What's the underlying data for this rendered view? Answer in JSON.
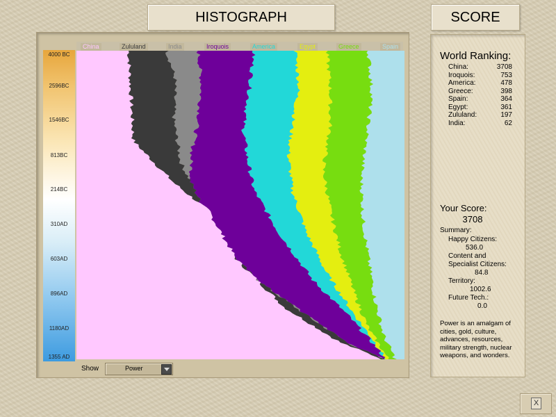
{
  "header": {
    "histograph_title": "HISTOGRAPH",
    "score_title": "SCORE"
  },
  "legend": [
    {
      "name": "China",
      "color": "#ffc8ff"
    },
    {
      "name": "Zululand",
      "color": "#3a3a3a"
    },
    {
      "name": "India",
      "color": "#8a8a8a"
    },
    {
      "name": "Iroquois",
      "color": "#6e009a"
    },
    {
      "name": "America",
      "color": "#22d8d8"
    },
    {
      "name": "Egypt",
      "color": "#e4ee10"
    },
    {
      "name": "Greece",
      "color": "#77dd10"
    },
    {
      "name": "Spain",
      "color": "#aee0ec"
    }
  ],
  "timeline": [
    "4000 BC",
    "2596BC",
    "1546BC",
    "813BC",
    "214BC",
    "310AD",
    "603AD",
    "896AD",
    "1180AD",
    "1355 AD"
  ],
  "show": {
    "label": "Show",
    "value": "Power"
  },
  "ranking": {
    "title": "World Ranking:",
    "rows": [
      {
        "name": "China:",
        "score": "3708"
      },
      {
        "name": "Iroquois:",
        "score": "753"
      },
      {
        "name": "America:",
        "score": "478"
      },
      {
        "name": "Greece:",
        "score": "398"
      },
      {
        "name": "Spain:",
        "score": "364"
      },
      {
        "name": "Egypt:",
        "score": "361"
      },
      {
        "name": "Zululand:",
        "score": "197"
      },
      {
        "name": "India:",
        "score": "62"
      }
    ]
  },
  "your_score": {
    "title": "Your Score:",
    "value": "3708",
    "summary_label": "Summary:",
    "happy_label": "Happy Citizens:",
    "happy_value": "536.0",
    "content_label_1": "Content and",
    "content_label_2": "Specialist Citizens:",
    "content_value": "84.8",
    "territory_label": "Territory:",
    "territory_value": "1002.6",
    "future_label": "Future Tech.:",
    "future_value": "0.0",
    "description": "Power is an amalgam of cities, gold, culture, advances, resources, military strength, nuclear weapons, and wonders."
  },
  "close": {
    "label": "X"
  }
}
